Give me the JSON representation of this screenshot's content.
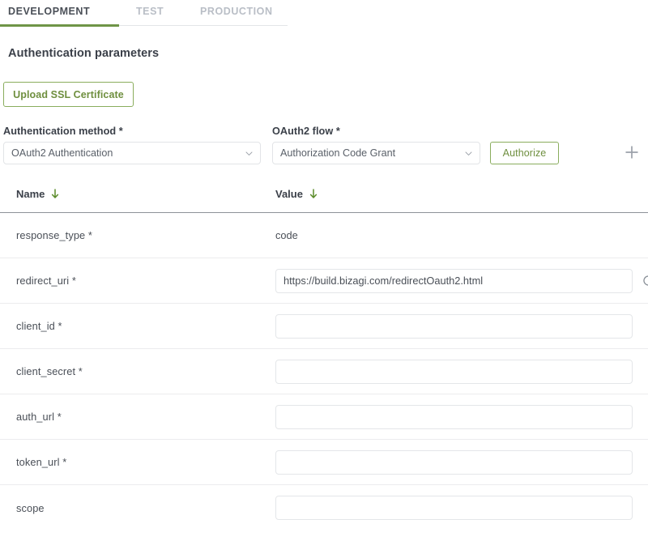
{
  "tabs": [
    {
      "label": "DEVELOPMENT",
      "active": true
    },
    {
      "label": "TEST",
      "active": false
    },
    {
      "label": "PRODUCTION",
      "active": false
    }
  ],
  "section": {
    "title": "Authentication parameters",
    "upload_button": "Upload SSL Certificate"
  },
  "fields": {
    "auth_method": {
      "label": "Authentication method",
      "required_marker": "*",
      "value": "OAuth2 Authentication"
    },
    "oauth_flow": {
      "label": "OAuth2 flow",
      "required_marker": "*",
      "value": "Authorization Code Grant"
    },
    "authorize_button": "Authorize",
    "add_icon_name": "plus-icon"
  },
  "table": {
    "columns": [
      {
        "label": "Name",
        "sort": "descending"
      },
      {
        "label": "Value",
        "sort": "descending"
      }
    ],
    "rows": [
      {
        "name": "response_type",
        "required_marker": "*",
        "value_type": "text",
        "value": "code"
      },
      {
        "name": "redirect_uri",
        "required_marker": "*",
        "value_type": "input",
        "value": "https://build.bizagi.com/redirectOauth2.html",
        "placeholder": "",
        "icons": [
          "reset-icon",
          "copy-icon"
        ]
      },
      {
        "name": "client_id",
        "required_marker": "*",
        "value_type": "input",
        "value": "",
        "placeholder": "",
        "icons": []
      },
      {
        "name": "client_secret",
        "required_marker": "*",
        "value_type": "input",
        "value": "",
        "placeholder": "",
        "icons": []
      },
      {
        "name": "auth_url",
        "required_marker": "*",
        "value_type": "input",
        "value": "",
        "placeholder": "",
        "icons": []
      },
      {
        "name": "token_url",
        "required_marker": "*",
        "value_type": "input",
        "value": "",
        "placeholder": "",
        "icons": []
      },
      {
        "name": "scope",
        "required_marker": "",
        "value_type": "input",
        "value": "",
        "placeholder": "",
        "icons": []
      }
    ]
  },
  "colors": {
    "accent_green": "#6f9547",
    "button_green": "#6f8f3f",
    "text_dark": "#3b4049",
    "text_muted": "#4a4f57",
    "tab_inactive": "#b9bec6",
    "border_light": "#e2e4e7",
    "header_rule": "#8d9299"
  }
}
